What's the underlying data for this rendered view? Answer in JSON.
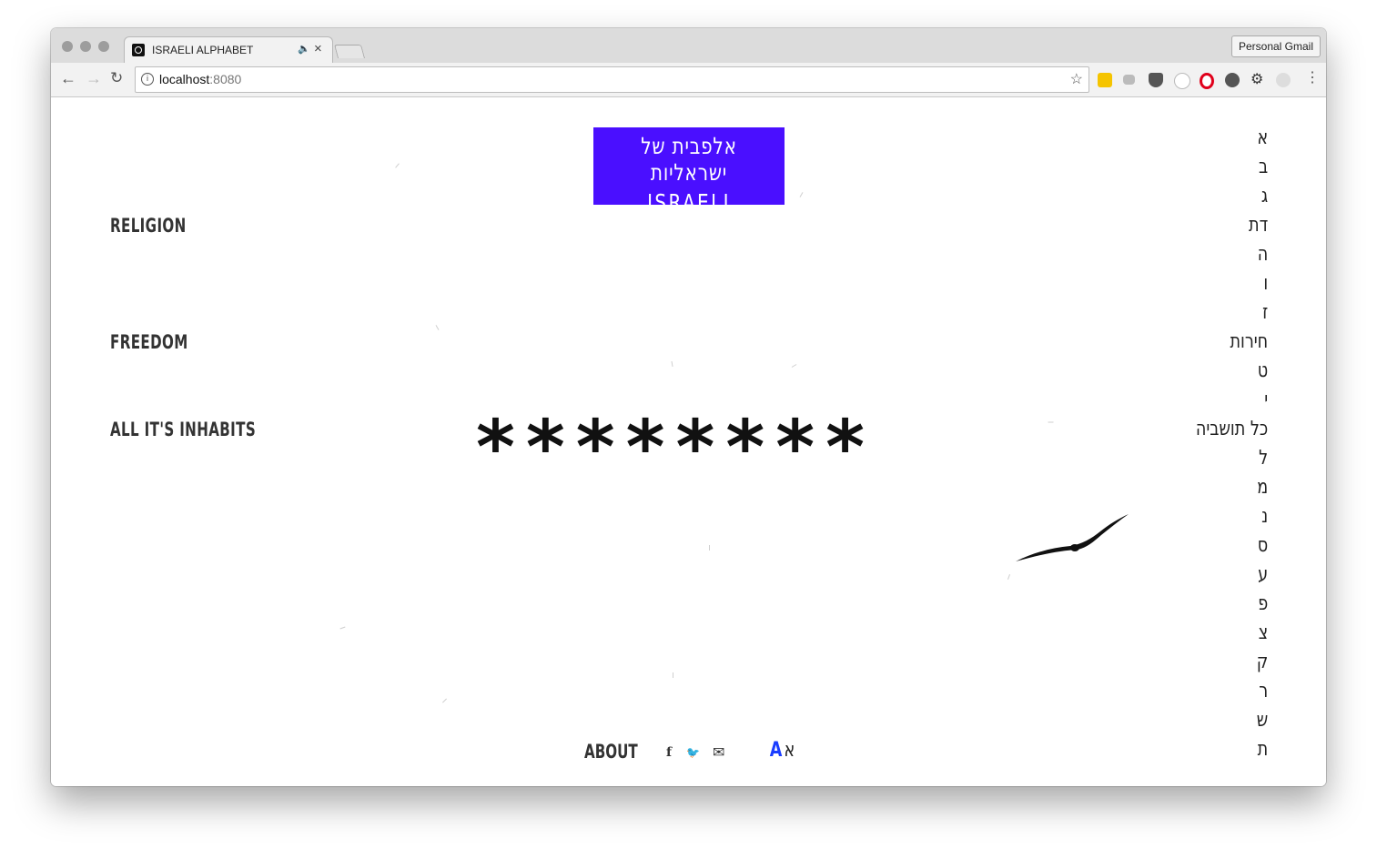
{
  "browser": {
    "tab_title": "ISRAELI ALPHABET",
    "audio_icon": "speaker-icon",
    "close_glyph": "×",
    "profile_label": "Personal Gmail",
    "url_host": "localhost",
    "url_port": ":8080",
    "back_glyph": "←",
    "forward_glyph": "→",
    "reload_glyph": "↻",
    "info_glyph": "i",
    "star_glyph": "☆",
    "menu_glyph": "⋮",
    "extensions": [
      "yellow-extension-icon",
      "camera-icon",
      "pocket-icon",
      "circle-extension-icon",
      "opera-icon",
      "record-icon",
      "gear-icon",
      "m-extension-icon"
    ]
  },
  "logo": {
    "hebrew": "אלפבית של ישראליות",
    "english": "ISRAELI ALPHABET",
    "background": "#4a0fff"
  },
  "left_words": [
    "RELIGION",
    "FREEDOM",
    "ALL IT'S INHABITS"
  ],
  "center_text": "********",
  "hebrew_index": [
    "א",
    "ב",
    "ג",
    "דת",
    "ה",
    "ו",
    "ז",
    "חירות",
    "ט",
    "י",
    "כל תושביה",
    "ל",
    "מ",
    "נ",
    "ס",
    "ע",
    "פ",
    "צ",
    "ק",
    "ר",
    "ש",
    "ת"
  ],
  "footer": {
    "about_label": "ABOUT",
    "social": [
      "facebook-icon",
      "twitter-icon",
      "mail-icon"
    ],
    "facebook_glyph": "f",
    "twitter_glyph": "🐦",
    "mail_glyph": "✉",
    "lang_en": "A",
    "lang_he": "א"
  },
  "colors": {
    "accent": "#4a0fff",
    "lang_active": "#1a3dff",
    "text": "#333333"
  }
}
